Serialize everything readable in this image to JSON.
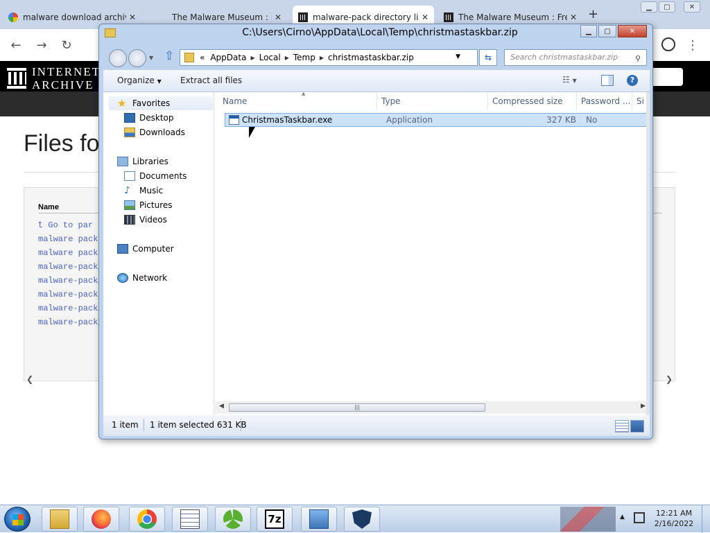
{
  "browser": {
    "tabs": [
      {
        "title": "malware download archive.o",
        "icon": "google-icon",
        "active": false
      },
      {
        "title": "The Malware Museum : Free",
        "icon": "internet-archive-icon",
        "active": false
      },
      {
        "title": "malware-pack directory listin",
        "icon": "internet-archive-icon",
        "active": true
      },
      {
        "title": "The Malware Museum : Free",
        "icon": "internet-archive-icon",
        "active": false
      }
    ],
    "new_tab": "+",
    "back": "←",
    "forward": "→",
    "reload": "↻",
    "menu": "⋮"
  },
  "ia": {
    "logo_line1": "INTERNET",
    "logo_line2": "ARCHIVE",
    "page_title": "Files fo",
    "table_header": "Name",
    "links": [
      "Go to par",
      "malware pack",
      "malware pack",
      "malware-pack_",
      "malware-pack_",
      "malware-pack_",
      "malware-pack_",
      "malware-pack_"
    ]
  },
  "explorer": {
    "title": "C:\\Users\\Cirno\\AppData\\Local\\Temp\\christmastaskbar.zip",
    "breadcrumb": [
      "«",
      "AppData",
      "Local",
      "Temp",
      "christmastaskbar.zip"
    ],
    "search_placeholder": "Search christmastaskbar.zip",
    "commands": {
      "organize": "Organize",
      "extract": "Extract all files"
    },
    "nav": {
      "favorites": "Favorites",
      "desktop": "Desktop",
      "downloads": "Downloads",
      "libraries": "Libraries",
      "documents": "Documents",
      "music": "Music",
      "pictures": "Pictures",
      "videos": "Videos",
      "computer": "Computer",
      "network": "Network"
    },
    "columns": [
      "Name",
      "Type",
      "Compressed size",
      "Password ...",
      "Si"
    ],
    "files": [
      {
        "name": "ChristmasTaskbar.exe",
        "type": "Application",
        "compressed_size": "327 KB",
        "password": "No"
      }
    ],
    "status": {
      "count": "1 item",
      "selected": "1 item selected  631 KB"
    }
  },
  "taskbar": {
    "apps": [
      "explorer",
      "firefox",
      "chrome",
      "notepad",
      "recycle",
      "7zip",
      "control-panel",
      "shield"
    ],
    "sevenzip_label": "7z",
    "time": "12:21 AM",
    "date": "2/16/2022"
  },
  "colors": {
    "tab_strip": "#c9d6e9",
    "ia_black": "#000000",
    "link_blue": "#4b64b8",
    "selection": "#cce2f9",
    "aero_frame": "#bed3ee"
  }
}
